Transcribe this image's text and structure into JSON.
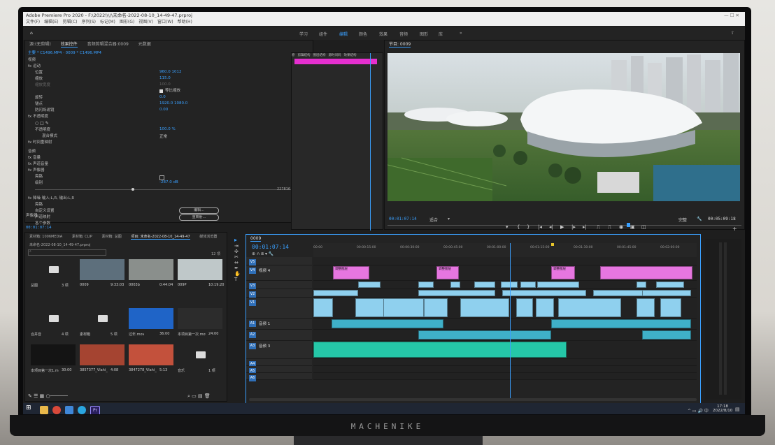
{
  "window": {
    "title": "Adobe Premiere Pro 2020 - F:\\2022\\\\\\\\\\未命名-2022-08-10_14-49-47.prproj",
    "menu": [
      "文件(F)",
      "编辑(E)",
      "剪辑(C)",
      "序列(S)",
      "标记(M)",
      "图形(G)",
      "视图(V)",
      "窗口(W)",
      "帮助(H)"
    ]
  },
  "workspaces": [
    "学习",
    "组件",
    "编辑",
    "颜色",
    "效果",
    "音频",
    "图形",
    "库"
  ],
  "effect_controls": {
    "tabs": [
      "源:(无剪辑)",
      "效果控件",
      "音频剪辑混合器:0009",
      "元数据"
    ],
    "breadcrumb": "主要 * C1496.MP4  ·  0009 * C1496.MP4",
    "section_video": "视频",
    "rows": [
      {
        "label": "fx 运动",
        "value": ""
      },
      {
        "label": "位置",
        "value": "960.0  1012"
      },
      {
        "label": "缩放",
        "value": "115.0"
      },
      {
        "label": "缩放宽度",
        "value": "100.0"
      },
      {
        "label": "等比缩放",
        "value": ""
      },
      {
        "label": "旋转",
        "value": "0.0"
      },
      {
        "label": "锚点",
        "value": "1920.0  1080.0"
      },
      {
        "label": "防闪烁滤镜",
        "value": "0.00"
      },
      {
        "label": "fx 不透明度",
        "value": ""
      },
      {
        "label": "不透明度",
        "value": "100.0 %"
      },
      {
        "label": "混合模式",
        "value": "正常"
      },
      {
        "label": "fx 时间重映射",
        "value": ""
      }
    ],
    "section_audio": "音频",
    "audio_rows": [
      {
        "label": "fx 音量",
        "value": ""
      },
      {
        "label": "fx 声道音量",
        "value": ""
      },
      {
        "label": "fx 声像器",
        "value": ""
      },
      {
        "label": "旁路",
        "value": ""
      },
      {
        "label": "级别",
        "value": "-287.0 dB"
      }
    ],
    "lower_rows": [
      {
        "label": "fx 降噪 输入:L,R,  输出:L,R"
      },
      {
        "label": "旁路"
      },
      {
        "label": "自定义设置"
      },
      {
        "label": "声道映射"
      },
      {
        "label": "各个参数"
      },
      {
        "label": "声像器"
      }
    ],
    "buttons": [
      "编辑...",
      "重映射..."
    ],
    "timecode_left": "00:01:07:14",
    "value_right": "227816"
  },
  "source_mini": {
    "tabs": [
      "原",
      "剪辑结构",
      "图层结构",
      "源时间码",
      "效果结构"
    ]
  },
  "program": {
    "title": "节目: 0009",
    "timecode": "00:01:07:14",
    "fit": "适合",
    "quality": "完整",
    "duration": "00:05:09:18"
  },
  "project": {
    "tabs": [
      "素材箱: 1006MEDIA",
      "素材箱: CLIP",
      "素材箱: 总图",
      "项目: 未命名-2022-08-10_14-49-47",
      "媒体浏览器"
    ],
    "path": "未命名-2022-08-10_14-49-47.prproj",
    "count": "12 项",
    "items": [
      {
        "name": "总图",
        "meta": "3 项",
        "kind": "folder"
      },
      {
        "name": "0009",
        "meta": "9:33:03",
        "kind": "clip"
      },
      {
        "name": "0003b",
        "meta": "0:44:04",
        "kind": "clip"
      },
      {
        "name": "009P",
        "meta": "10:19:20",
        "kind": "clip"
      },
      {
        "name": "合并音",
        "meta": "4 项",
        "kind": "folder"
      },
      {
        "name": "素材箱",
        "meta": "5 项",
        "kind": "folder"
      },
      {
        "name": "过年.mov",
        "meta": "36:00",
        "kind": "clip"
      },
      {
        "name": "本项目第一次.mov",
        "meta": "24:00",
        "kind": "clip"
      },
      {
        "name": "本项目第一次1.mov",
        "meta": "30:00",
        "kind": "clip"
      },
      {
        "name": "3857377_Vlahi_3f2e64b...",
        "meta": "4:08",
        "kind": "clip"
      },
      {
        "name": "3847278_Vlahi_3ef7665...",
        "meta": "5:13",
        "kind": "clip"
      },
      {
        "name": "音乐",
        "meta": "1 项",
        "kind": "folder"
      }
    ]
  },
  "timeline": {
    "tab": "0009",
    "timecode": "00:01:07:14",
    "ruler": [
      "00:00",
      "00:00:15:00",
      "00:00:30:00",
      "00:00:45:00",
      "00:01:00:00",
      "00:01:15:00",
      "00:01:30:00",
      "00:01:45:00",
      "00:02:00:00"
    ],
    "tracks": [
      {
        "id": "V5",
        "name": ""
      },
      {
        "id": "V4",
        "name": "视频 4"
      },
      {
        "id": "V3",
        "name": ""
      },
      {
        "id": "V2",
        "name": ""
      },
      {
        "id": "V1",
        "name": ""
      },
      {
        "id": "A1",
        "name": "音频 1"
      },
      {
        "id": "A2",
        "name": ""
      },
      {
        "id": "A3",
        "name": "音频 3"
      },
      {
        "id": "A4",
        "name": ""
      },
      {
        "id": "A5",
        "name": ""
      },
      {
        "id": "A6",
        "name": ""
      }
    ],
    "pink_clips": [
      "调整图层",
      "调整图层",
      "调整图层",
      "调整图层"
    ]
  },
  "taskbar": {
    "time": "17:18",
    "date": "2022/8/10"
  },
  "monitor_brand": "MACHENIKE"
}
